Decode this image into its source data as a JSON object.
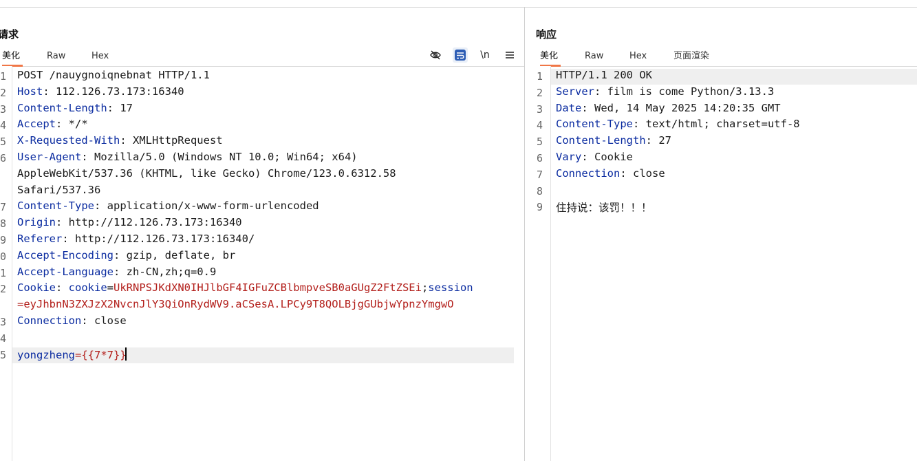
{
  "request": {
    "title": "请求",
    "tabs": [
      "美化",
      "Raw",
      "Hex"
    ],
    "active_tab": "美化",
    "toolbar_icons": [
      "eye-off-icon",
      "wrap-lines-icon",
      "newline-toggle-icon",
      "menu-icon"
    ],
    "newline_label": "\\n",
    "line_numbers": [
      "1",
      "2",
      "3",
      "4",
      "5",
      "6",
      "",
      "",
      "7",
      "8",
      "9",
      "0",
      "1",
      "2",
      "",
      "3",
      "4",
      "5"
    ],
    "lines": [
      {
        "k": "",
        "sep": "",
        "v": "POST /nauygnoiqnebnat HTTP/1.1"
      },
      {
        "k": "Host",
        "sep": ": ",
        "v": "112.126.73.173:16340"
      },
      {
        "k": "Content-Length",
        "sep": ": ",
        "v": "17"
      },
      {
        "k": "Accept",
        "sep": ": ",
        "v": "*/*"
      },
      {
        "k": "X-Requested-With",
        "sep": ": ",
        "v": "XMLHttpRequest"
      },
      {
        "k": "User-Agent",
        "sep": ": ",
        "v": "Mozilla/5.0 (Windows NT 10.0; Win64; x64)"
      },
      {
        "k": "",
        "sep": "",
        "v": "AppleWebKit/537.36 (KHTML, like Gecko) Chrome/123.0.6312.58"
      },
      {
        "k": "",
        "sep": "",
        "v": "Safari/537.36"
      },
      {
        "k": "Content-Type",
        "sep": ": ",
        "v": "application/x-www-form-urlencoded"
      },
      {
        "k": "Origin",
        "sep": ": ",
        "v": "http://112.126.73.173:16340"
      },
      {
        "k": "Referer",
        "sep": ": ",
        "v": "http://112.126.73.173:16340/"
      },
      {
        "k": "Accept-Encoding",
        "sep": ": ",
        "v": "gzip, deflate, br"
      },
      {
        "k": "Accept-Language",
        "sep": ": ",
        "v": "zh-CN,zh;q=0.9"
      }
    ],
    "cookie_line": {
      "key": "Cookie",
      "sep": ": ",
      "c1_name": "cookie",
      "c1_eq": "=",
      "c1_value": "UkRNPSJKdXN0IHJlbGF4IGFuZCBlbmpveSB0aGUgZ2FtZSEi",
      "semicolon": ";",
      "c2_name": "session",
      "c2_cont": "=eyJhbnN3ZXJzX2NvcnJlY3QiOnRydWV9.aCSesA.LPCy9T8QOLBjgGUbjwYpnzYmgwO"
    },
    "connection_line": {
      "k": "Connection",
      "sep": ": ",
      "v": "close"
    },
    "body_line": {
      "param": "yongzheng",
      "eq": "=",
      "value": "{{7*7}}"
    }
  },
  "response": {
    "title": "响应",
    "tabs": [
      "美化",
      "Raw",
      "Hex",
      "页面渲染"
    ],
    "active_tab": "美化",
    "line_numbers": [
      "1",
      "2",
      "3",
      "4",
      "5",
      "6",
      "7",
      "8",
      "9"
    ],
    "lines": [
      {
        "k": "",
        "sep": "",
        "v": "HTTP/1.1 200 OK"
      },
      {
        "k": "Server",
        "sep": ": ",
        "v": "film is come Python/3.13.3"
      },
      {
        "k": "Date",
        "sep": ": ",
        "v": "Wed, 14 May 2025 14:20:35 GMT"
      },
      {
        "k": "Content-Type",
        "sep": ": ",
        "v": "text/html; charset=utf-8"
      },
      {
        "k": "Content-Length",
        "sep": ": ",
        "v": "27"
      },
      {
        "k": "Vary",
        "sep": ": ",
        "v": "Cookie"
      },
      {
        "k": "Connection",
        "sep": ": ",
        "v": "close"
      },
      {
        "k": "",
        "sep": "",
        "v": ""
      },
      {
        "k": "",
        "sep": "",
        "v": "住持说：该罚！！！"
      }
    ]
  },
  "colors": {
    "header_key": "#0a2ba0",
    "value_red": "#b3201c",
    "active_tab_underline": "#f07646",
    "line_highlight": "#efefef"
  }
}
